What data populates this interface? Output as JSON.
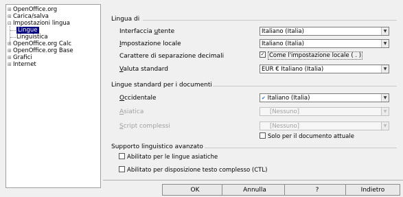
{
  "tree": {
    "items": [
      {
        "label": "OpenOffice.org",
        "toggle": "⊞"
      },
      {
        "label": "Carica/salva",
        "toggle": "⊞"
      },
      {
        "label": "Impostazioni lingua",
        "toggle": "⊟"
      },
      {
        "label": "Lingue",
        "toggle": ""
      },
      {
        "label": "Linguistica",
        "toggle": ""
      },
      {
        "label": "OpenOffice.org Calc",
        "toggle": "⊞"
      },
      {
        "label": "OpenOffice.org Base",
        "toggle": "⊞"
      },
      {
        "label": "Grafici",
        "toggle": "⊞"
      },
      {
        "label": "Internet",
        "toggle": "⊞"
      }
    ]
  },
  "lingua_di": {
    "title": "Lingua di",
    "interfaccia_label_pre": "Interfaccia ",
    "interfaccia_label_u": "u",
    "interfaccia_label_post": "tente",
    "interfaccia_value": "Italiano (Italia)",
    "impostazione_label_u": "I",
    "impostazione_label_post": "mpostazione locale",
    "impostazione_value": "Italiano (Italia)",
    "separatore_label": "Carattere di separazione decimali",
    "separatore_check_mark": "✓",
    "separatore_check_label": "Come l'impostazione locale ( . )",
    "valuta_label_u": "V",
    "valuta_label_post": "aluta standard",
    "valuta_value": "EUR  €  Italiano (Italia)"
  },
  "lingue_standard": {
    "title": "Lingue standard per i documenti",
    "occidentale_label_u": "O",
    "occidentale_label_post": "ccidentale",
    "occidentale_value": "Italiano (Italia)",
    "asiatica_label_u": "A",
    "asiatica_label_post": "siatica",
    "asiatica_value": "[Nessuno]",
    "script_label_u": "S",
    "script_label_post": "cript complessi",
    "script_value": "[Nessuno]",
    "solo_label": "Solo per il documento attuale"
  },
  "supporto": {
    "title": "Supporto linguistico avanzato",
    "asiatiche_label": "Abilitato per le lingue asiatiche",
    "ctl_label": "Abilitato per disposizione testo complesso (CTL)"
  },
  "buttons": {
    "ok": "OK",
    "annulla": "Annulla",
    "aiuto": "?",
    "indietro": "Indietro"
  }
}
